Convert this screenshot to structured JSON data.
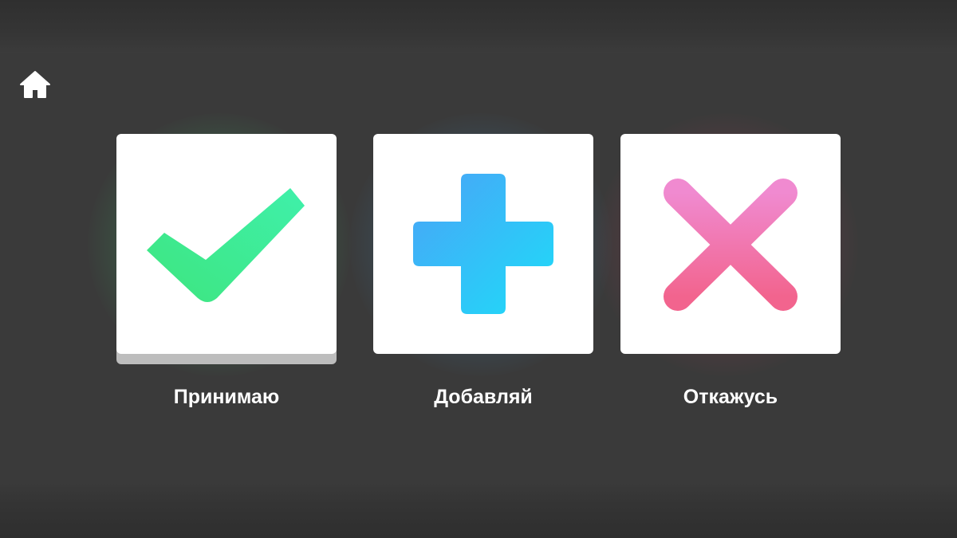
{
  "home": {
    "icon": "home-icon"
  },
  "options": [
    {
      "id": "accept",
      "label": "Принимаю",
      "icon": "checkmark-icon",
      "color": "#3ee88a",
      "glow": "#3c965a"
    },
    {
      "id": "add",
      "label": "Добавляй",
      "icon": "plus-icon",
      "color": "#2fbef5",
      "glow": "#3c78a0"
    },
    {
      "id": "refuse",
      "label": "Откажусь",
      "icon": "cross-icon",
      "color": "#f27aa8",
      "glow": "#963c50"
    }
  ]
}
